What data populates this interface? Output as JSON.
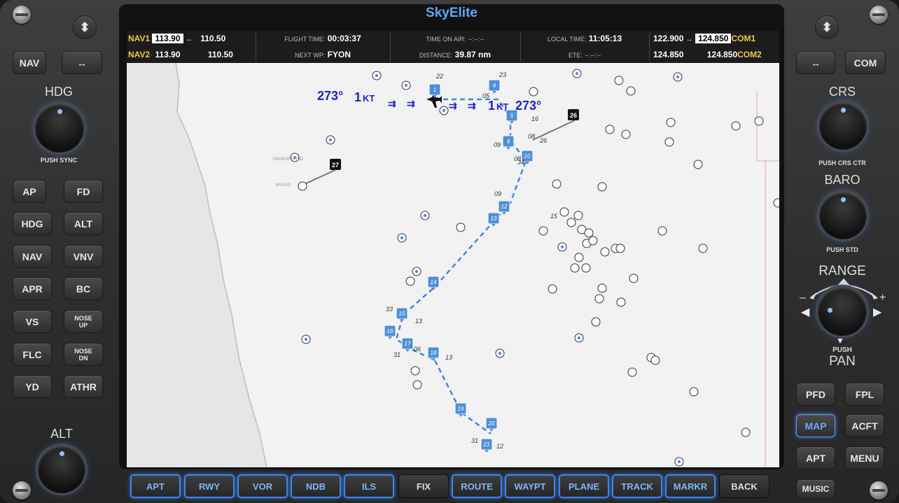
{
  "app_title": "SkyElite",
  "left_panel": {
    "nav_label": "NAV",
    "swap_label": "↔",
    "hdg_label": "HDG",
    "hdg_push": "PUSH SYNC",
    "buttons": [
      "AP",
      "FD",
      "HDG",
      "ALT",
      "NAV",
      "VNV",
      "APR",
      "BC",
      "VS",
      "NOSE UP",
      "FLC",
      "NOSE DN",
      "YD",
      "ATHR"
    ],
    "alt_label": "ALT"
  },
  "right_panel": {
    "swap_label": "↔",
    "com_label": "COM",
    "crs_label": "CRS",
    "crs_push": "PUSH CRS CTR",
    "baro_label": "BARO",
    "baro_push": "PUSH STD",
    "range_label": "RANGE",
    "range_push": "PUSH",
    "pan_label": "PAN",
    "buttons": [
      "PFD",
      "FPL",
      "MAP",
      "ACFT",
      "APT",
      "MENU"
    ],
    "music_label": "MUSIC"
  },
  "topbar": {
    "nav1_label": "NAV1",
    "nav1_active": "113.90",
    "nav1_standby": "110.50",
    "nav2_label": "NAV2",
    "nav2_active": "113.90",
    "nav2_standby": "110.50",
    "swap": "↔",
    "flight_time_label": "FLIGHT TIME:",
    "flight_time": "00:03:37",
    "next_wp_label": "NEXT WP:",
    "next_wp": "FYON",
    "time_on_air_label": "TIME ON AIR:",
    "time_on_air": "--:--:--",
    "distance_label": "DISTANCE:",
    "distance": "39.87 nm",
    "local_time_label": "LOCAL TIME:",
    "local_time": "11:05:13",
    "ete_label": "ETE:",
    "ete": "--:--:--",
    "com1_standby": "122.900",
    "com1_active": "124.850",
    "com1_label": "COM1",
    "com2_standby": "124.850",
    "com2_active": "124.850",
    "com2_label": "COM2"
  },
  "map": {
    "wind_left": "273°",
    "wind_speed_left": "1",
    "wind_unit": "KT",
    "wind_speed_right": "1",
    "wind_right": "273°",
    "place_name": "SWAKOPMUND",
    "place_name2": "WALVIS",
    "waypoints": [
      "1",
      "4",
      "5",
      "9",
      "10",
      "12",
      "13",
      "14",
      "15",
      "16",
      "17",
      "18",
      "19",
      "20",
      "21"
    ],
    "runway_markers": [
      "26",
      "27"
    ],
    "runway_numbers": [
      "22",
      "23",
      "05",
      "16",
      "08",
      "09",
      "26",
      "34",
      "08",
      "09",
      "15",
      "33",
      "13",
      "31",
      "06",
      "13",
      "31",
      "12",
      "30"
    ]
  },
  "softkeys": [
    {
      "label": "APT",
      "on": true
    },
    {
      "label": "RWY",
      "on": true
    },
    {
      "label": "VOR",
      "on": true
    },
    {
      "label": "NDB",
      "on": true
    },
    {
      "label": "ILS",
      "on": true
    },
    {
      "label": "FIX",
      "on": false
    },
    {
      "label": "ROUTE",
      "on": true
    },
    {
      "label": "WAYPT",
      "on": true
    },
    {
      "label": "PLANE",
      "on": true
    },
    {
      "label": "TRACK",
      "on": true
    },
    {
      "label": "MARKR",
      "on": true
    },
    {
      "label": "BACK",
      "on": false
    }
  ],
  "colors": {
    "accent": "#58a7ff",
    "route": "#3f86e8",
    "gold": "#f3c548",
    "wind": "#1f1fd6"
  }
}
